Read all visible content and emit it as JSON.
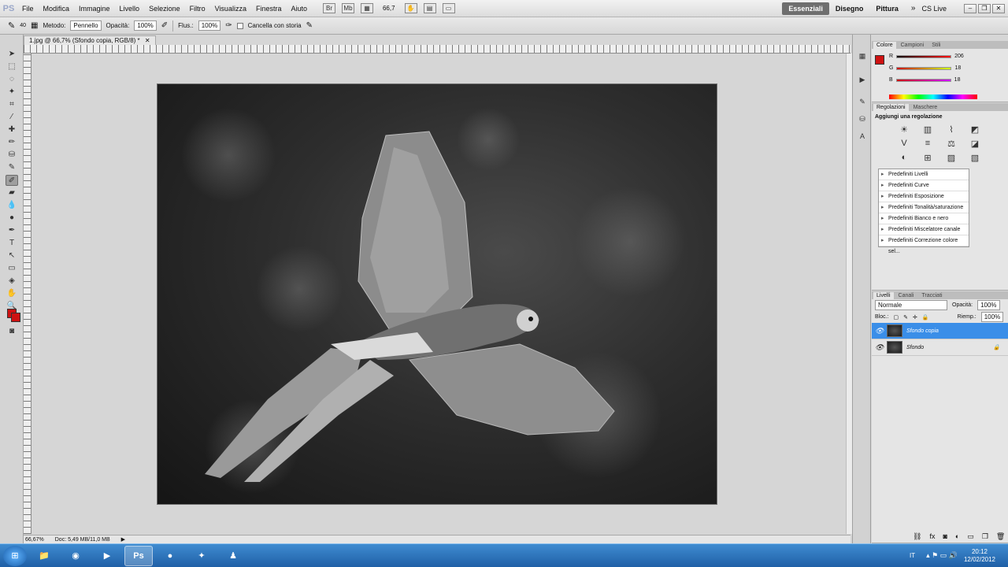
{
  "app": {
    "logo": "PS"
  },
  "menu": [
    "File",
    "Modifica",
    "Immagine",
    "Livello",
    "Selezione",
    "Filtro",
    "Visualizza",
    "Finestra",
    "Aiuto"
  ],
  "menubar_tools": {
    "zoom": "66,7"
  },
  "workspaces": [
    "Essenziali",
    "Disegno",
    "Pittura"
  ],
  "cs_live": "CS Live",
  "options_bar": {
    "brush_size": "40",
    "mode_label": "Metodo:",
    "mode_value": "Pennello",
    "opacity_label": "Opacità:",
    "opacity_value": "100%",
    "flow_label": "Flus.:",
    "flow_value": "100%",
    "erase_history_label": "Cancella con storia"
  },
  "document": {
    "tab_title": "1.jpg @ 66,7% (Sfondo copia, RGB/8) *",
    "zoom_status": "66,67%",
    "doc_status": "Doc: 5,49 MB/11,0 MB"
  },
  "color_panel": {
    "tabs": [
      "Colore",
      "Campioni",
      "Stili"
    ],
    "channels": [
      {
        "label": "R",
        "value": "206"
      },
      {
        "label": "G",
        "value": "18"
      },
      {
        "label": "B",
        "value": "18"
      }
    ],
    "fg_color": "#ce1212"
  },
  "adjustments_panel": {
    "tabs": [
      "Regolazioni",
      "Maschere"
    ],
    "title": "Aggiungi una regolazione",
    "presets": [
      "Predefiniti Livelli",
      "Predefiniti Curve",
      "Predefiniti Esposizione",
      "Predefiniti Tonalità/saturazione",
      "Predefiniti Bianco e nero",
      "Predefiniti Miscelatore canale",
      "Predefiniti Correzione colore sel..."
    ]
  },
  "layers_panel": {
    "tabs": [
      "Livelli",
      "Canali",
      "Tracciati"
    ],
    "blend_mode": "Normale",
    "opacity_label": "Opacità:",
    "opacity_value": "100%",
    "lock_label": "Bloc.:",
    "fill_label": "Riemp.:",
    "fill_value": "100%",
    "layers": [
      {
        "name": "Sfondo copia",
        "selected": true
      },
      {
        "name": "Sfondo",
        "selected": false
      }
    ]
  },
  "taskbar": {
    "language": "IT",
    "time": "20:12",
    "date": "12/02/2012",
    "ps_label": "Ps"
  },
  "colors": {
    "selection_blue": "#3a8ee8",
    "foreground_red": "#ce1212"
  }
}
